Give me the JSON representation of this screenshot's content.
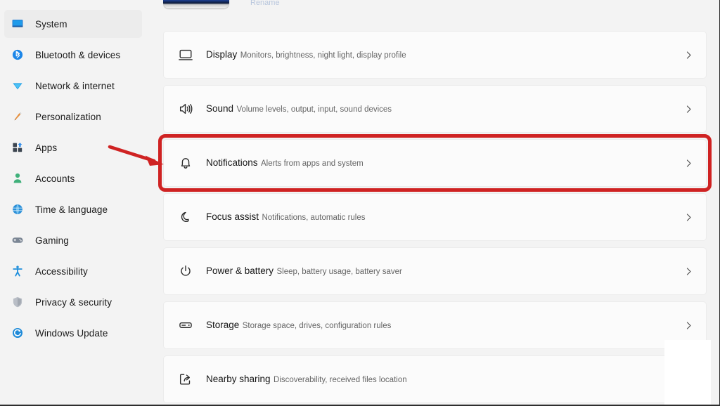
{
  "window": {
    "app_title": "Settings",
    "accent_color": "#0067c0",
    "highlight_color": "#cf2222",
    "page_background": "#f3f3f3",
    "card_background": "#fbfbfb"
  },
  "device_header": {
    "rename_label": "Rename",
    "thumbnail_icon": "monitor-thumbnail"
  },
  "sidebar": {
    "items": [
      {
        "label": "System",
        "icon": "monitor-icon",
        "selected": true
      },
      {
        "label": "Bluetooth & devices",
        "icon": "bluetooth-icon",
        "selected": false
      },
      {
        "label": "Network & internet",
        "icon": "network-icon",
        "selected": false
      },
      {
        "label": "Personalization",
        "icon": "paintbrush-icon",
        "selected": false
      },
      {
        "label": "Apps",
        "icon": "apps-icon",
        "selected": false
      },
      {
        "label": "Accounts",
        "icon": "person-icon",
        "selected": false
      },
      {
        "label": "Time & language",
        "icon": "clock-globe-icon",
        "selected": false
      },
      {
        "label": "Gaming",
        "icon": "gamepad-icon",
        "selected": false
      },
      {
        "label": "Accessibility",
        "icon": "accessibility-icon",
        "selected": false
      },
      {
        "label": "Privacy & security",
        "icon": "shield-icon",
        "selected": false
      },
      {
        "label": "Windows Update",
        "icon": "update-icon",
        "selected": false
      }
    ]
  },
  "main": {
    "cards": [
      {
        "title": "Display",
        "subtitle": "Monitors, brightness, night light, display profile",
        "icon": "display-icon",
        "chevron": "chevron-right-icon",
        "highlighted": false
      },
      {
        "title": "Sound",
        "subtitle": "Volume levels, output, input, sound devices",
        "icon": "speaker-icon",
        "chevron": "chevron-right-icon",
        "highlighted": false
      },
      {
        "title": "Notifications",
        "subtitle": "Alerts from apps and system",
        "icon": "bell-icon",
        "chevron": "chevron-right-icon",
        "highlighted": true
      },
      {
        "title": "Focus assist",
        "subtitle": "Notifications, automatic rules",
        "icon": "moon-icon",
        "chevron": "chevron-right-icon",
        "highlighted": false
      },
      {
        "title": "Power & battery",
        "subtitle": "Sleep, battery usage, battery saver",
        "icon": "power-icon",
        "chevron": "chevron-right-icon",
        "highlighted": false
      },
      {
        "title": "Storage",
        "subtitle": "Storage space, drives, configuration rules",
        "icon": "drive-icon",
        "chevron": "chevron-right-icon",
        "highlighted": false
      },
      {
        "title": "Nearby sharing",
        "subtitle": "Discoverability, received files location",
        "icon": "share-icon",
        "chevron": "chevron-right-icon",
        "highlighted": false
      }
    ]
  },
  "annotations": {
    "arrow": {
      "name": "red-pointer-arrow",
      "color": "#cf2222",
      "points_to": "Notifications"
    },
    "ring": {
      "name": "red-highlight-ring",
      "color": "#cf2222",
      "around": "Notifications"
    },
    "redaction": {
      "name": "white-redaction-box",
      "color": "#ffffff"
    }
  }
}
